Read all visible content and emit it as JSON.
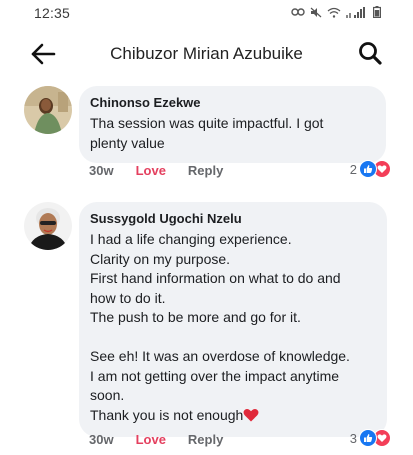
{
  "status_bar": {
    "time": "12:35"
  },
  "header": {
    "title": "Chibuzor Mirian Azubuike"
  },
  "comments": [
    {
      "author": "Chinonso Ezekwe",
      "lines": [
        "Tha session was quite impactful. I got",
        "plenty value"
      ],
      "time": "30w",
      "love_label": "Love",
      "reply_label": "Reply",
      "reaction_count": "2"
    },
    {
      "author": "Sussygold Ugochi Nzelu",
      "lines": [
        "I had  a life changing experience.",
        "Clarity on my purpose.",
        "First hand information on what to do and",
        "how to do it.",
        "The push to be more and go for it.",
        "",
        "See eh! It was an overdose of knowledge.",
        "I am not getting over the impact anytime",
        "soon.",
        "Thank you is not enough"
      ],
      "time": "30w",
      "love_label": "Love",
      "reply_label": "Reply",
      "reaction_count": "3"
    }
  ],
  "colors": {
    "love": "#e4405f",
    "like_reaction": "#1877f2",
    "love_reaction": "#f33e58",
    "bubble": "#f0f2f5"
  },
  "icons": {
    "back": "back-arrow-icon",
    "search": "search-icon",
    "like": "like-reaction-icon",
    "love": "love-reaction-icon",
    "heart": "heart-emoji-icon"
  }
}
